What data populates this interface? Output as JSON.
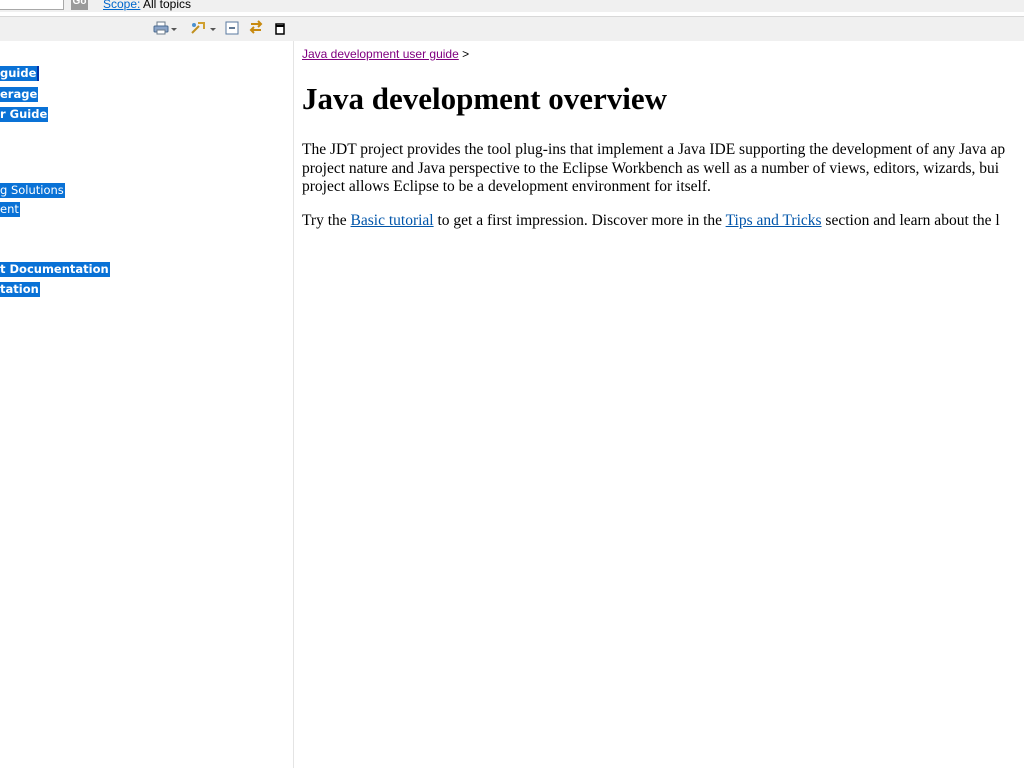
{
  "search": {
    "go_label": "Go",
    "scope_label": "Scope:",
    "scope_value": "All topics"
  },
  "toolbar": {
    "icons": [
      "print-icon",
      "synchronize-icon",
      "collapse-all-icon",
      "link-with-contents-icon",
      "maximize-icon"
    ]
  },
  "toc": {
    "items": [
      {
        "label": "guide",
        "weight": "bold"
      },
      {
        "label": "erage",
        "weight": "bold"
      },
      {
        "label": "r Guide",
        "weight": "bold"
      },
      {
        "label": "g Solutions",
        "weight": "normal"
      },
      {
        "label": "ent",
        "weight": "normal"
      },
      {
        "label": "t Documentation",
        "weight": "bold"
      },
      {
        "label": "tation",
        "weight": "bold"
      }
    ]
  },
  "content": {
    "breadcrumb": {
      "link": "Java development user guide",
      "separator": ">"
    },
    "title": "Java development overview",
    "para1": {
      "line1": "The JDT project provides the tool plug-ins that implement a Java IDE supporting the development of any Java ap",
      "line2": "project nature and Java perspective to the Eclipse Workbench as well as a number of views, editors, wizards, bui",
      "line3": "project allows Eclipse to be a development environment for itself."
    },
    "para2": {
      "text1": "Try the ",
      "link1": "Basic tutorial",
      "text2": " to get a first impression. Discover more in the ",
      "link2": "Tips and Tricks",
      "text3": " section and learn about the l"
    }
  }
}
